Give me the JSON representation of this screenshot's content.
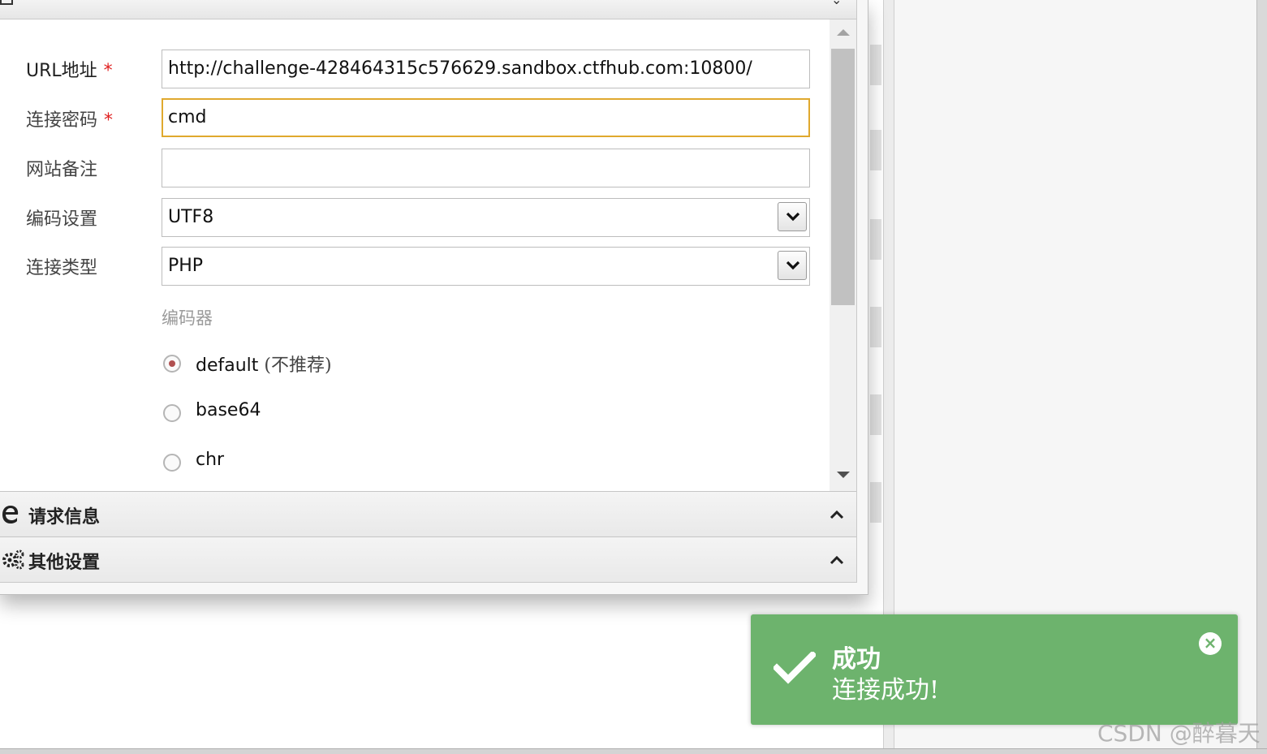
{
  "form": {
    "url_label": "URL地址",
    "url_required_mark": "*",
    "url_value": "http://challenge-428464315c576629.sandbox.ctfhub.com:10800/",
    "password_label": "连接密码",
    "password_required_mark": "*",
    "password_value": "cmd",
    "note_label": "网站备注",
    "note_value": "",
    "encoding_label": "编码设置",
    "encoding_value": "UTF8",
    "type_label": "连接类型",
    "type_value": "PHP",
    "encoder_heading": "编码器",
    "encoders": [
      {
        "name": "default",
        "note": "(不推荐)",
        "checked": true
      },
      {
        "name": "base64",
        "note": "",
        "checked": false
      },
      {
        "name": "chr",
        "note": "",
        "checked": false
      }
    ]
  },
  "sections": {
    "request_info": "请求信息",
    "other_settings": "其他设置"
  },
  "toast": {
    "title": "成功",
    "message": "连接成功!",
    "close_symbol": "×",
    "color": "#6db36d"
  },
  "watermark": "CSDN @醉暮天",
  "icons": {
    "request_section": "ie-icon",
    "other_section": "gears-icon",
    "toast": "checkmark-icon"
  }
}
